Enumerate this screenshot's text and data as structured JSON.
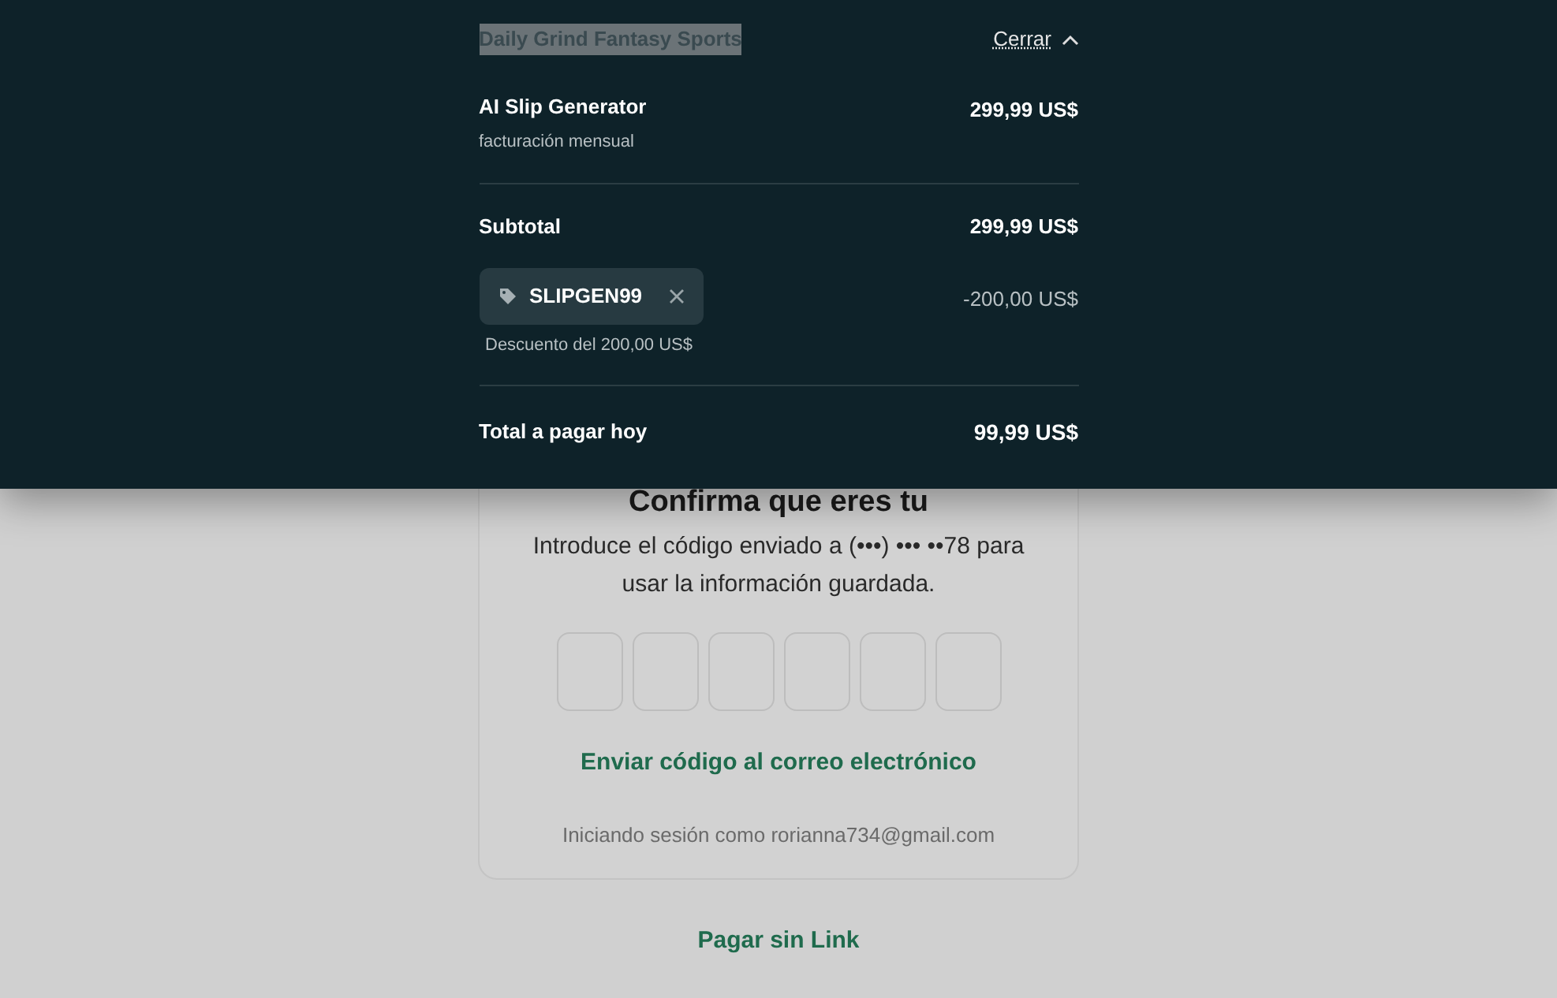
{
  "summary": {
    "merchant": {
      "text": "Daily Grind Fantasy Sports",
      "highlighted": true
    },
    "close_label": "Cerrar",
    "item": {
      "name": "AI Slip Generator",
      "billing": "facturación mensual",
      "price": "299,99 US$"
    },
    "subtotal": {
      "label": "Subtotal",
      "amount": "299,99 US$"
    },
    "promo": {
      "code": "SLIPGEN99",
      "description": "Descuento del 200,00 US$",
      "amount": "-200,00 US$"
    },
    "total": {
      "label": "Total a pagar hoy",
      "amount": "99,99 US$"
    }
  },
  "verify": {
    "title": "Confirma que eres tu",
    "message": "Introduce el código enviado a (•••) ••• ••78 para usar la información guardada.",
    "code_boxes": [
      {
        "kind": "digit"
      },
      {
        "kind": "digit"
      },
      {
        "kind": "digit"
      },
      {
        "kind": "digit"
      },
      {
        "kind": "digit"
      },
      {
        "kind": "digit"
      }
    ],
    "email_link": "Enviar código al correo electrónico",
    "signed_in": "Iniciando sesión como rorianna734@gmail.com"
  },
  "pay_without_link": "Pagar sin Link"
}
